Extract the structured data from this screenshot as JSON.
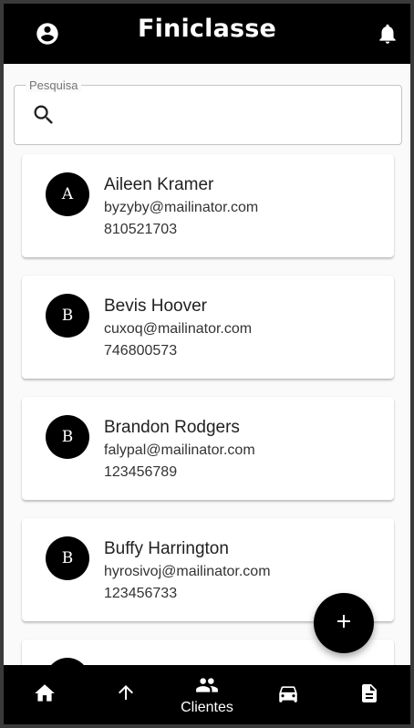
{
  "appbar": {
    "title": "Finiclasse",
    "left_icon": "account-circle-icon",
    "right_icon": "bell-icon"
  },
  "search": {
    "label": "Pesquisa",
    "value": "",
    "icon": "search-icon"
  },
  "clients": [
    {
      "initial": "A",
      "name": "Aileen Kramer",
      "email": "byzyby@mailinator.com",
      "phone": "810521703"
    },
    {
      "initial": "B",
      "name": "Bevis Hoover",
      "email": "cuxoq@mailinator.com",
      "phone": "746800573"
    },
    {
      "initial": "B",
      "name": "Brandon Rodgers",
      "email": "falypal@mailinator.com",
      "phone": "123456789"
    },
    {
      "initial": "B",
      "name": "Buffy Harrington",
      "email": "hyrosivoj@mailinator.com",
      "phone": "123456733"
    },
    {
      "initial": "",
      "name": "",
      "email": "",
      "phone": ""
    }
  ],
  "fab": {
    "icon": "plus-icon"
  },
  "bottom_nav": {
    "items": [
      {
        "icon": "home-icon",
        "label": ""
      },
      {
        "icon": "arrow-up-icon",
        "label": ""
      },
      {
        "icon": "people-icon",
        "label": "Clientes",
        "active": true
      },
      {
        "icon": "car-icon",
        "label": ""
      },
      {
        "icon": "document-icon",
        "label": ""
      }
    ]
  },
  "colors": {
    "bar": "#000000",
    "background": "#fafafa",
    "card": "#ffffff"
  }
}
